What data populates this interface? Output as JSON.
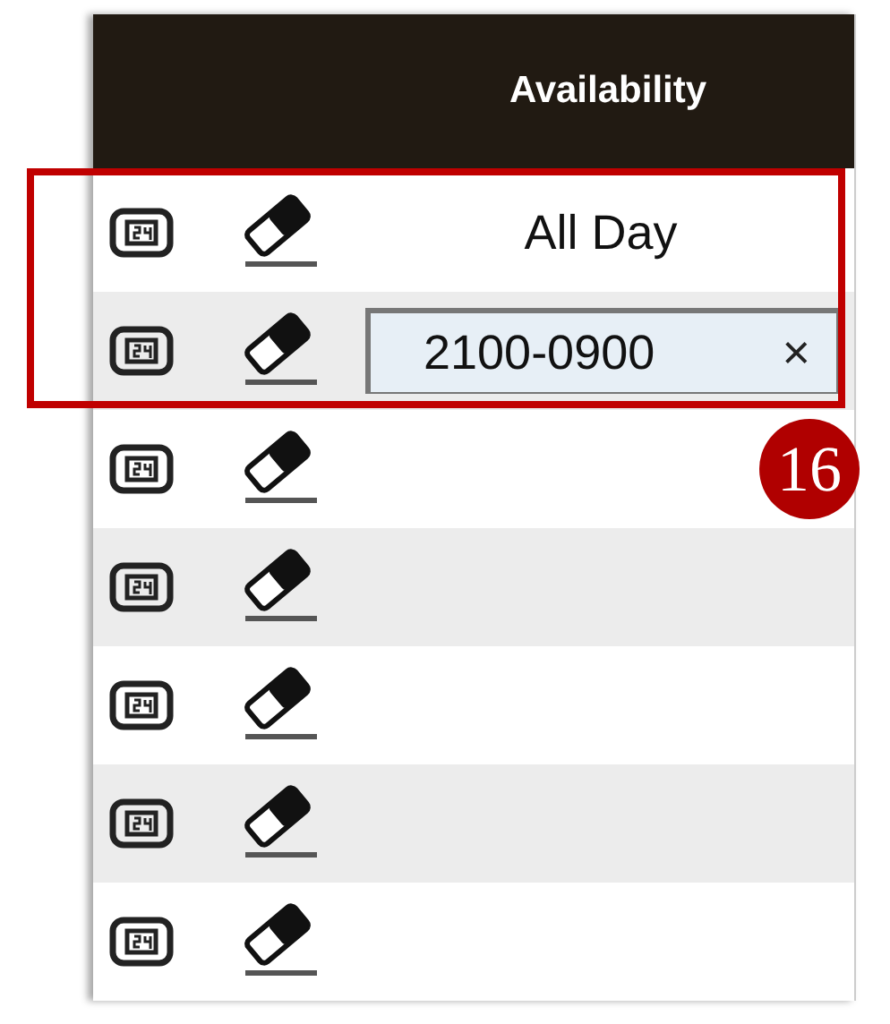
{
  "table": {
    "columns": [
      {
        "label": "Availability"
      }
    ],
    "rows": [
      {
        "kind": "text",
        "availability": "All Day"
      },
      {
        "kind": "input",
        "value": "2100-0900",
        "clear": "×"
      },
      {
        "kind": "empty"
      },
      {
        "kind": "empty"
      },
      {
        "kind": "empty"
      },
      {
        "kind": "empty"
      },
      {
        "kind": "empty"
      }
    ]
  },
  "callout": {
    "number": "16"
  }
}
